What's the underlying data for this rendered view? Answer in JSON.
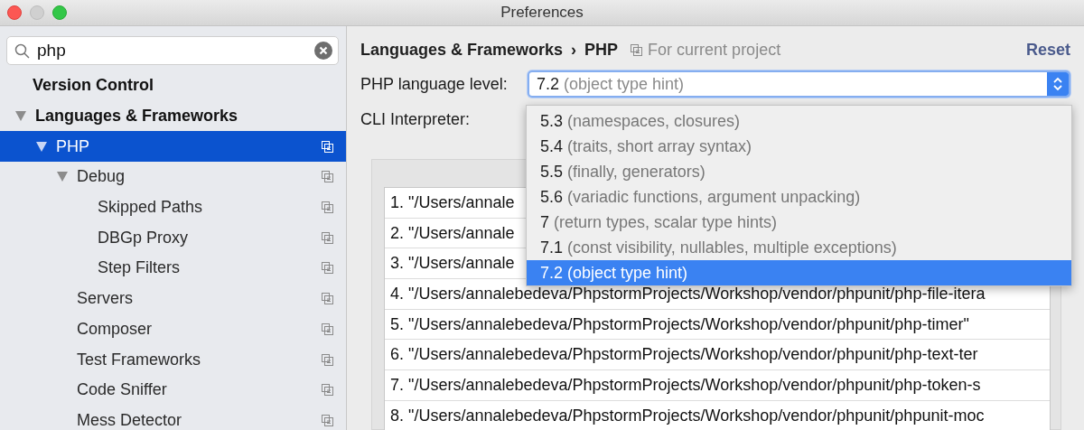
{
  "window": {
    "title": "Preferences"
  },
  "search": {
    "value": "php"
  },
  "tree": [
    {
      "label": "Version Control",
      "selected": false,
      "project_icon": false
    },
    {
      "label": "Languages & Frameworks",
      "expanded": true,
      "selected": false,
      "project_icon": false,
      "children": [
        {
          "label": "PHP",
          "expanded": true,
          "selected": true,
          "project_icon": true,
          "children": [
            {
              "label": "Debug",
              "expanded": true,
              "selected": false,
              "project_icon": true,
              "children": [
                {
                  "label": "Skipped Paths",
                  "selected": false,
                  "project_icon": true
                },
                {
                  "label": "DBGp Proxy",
                  "selected": false,
                  "project_icon": true
                },
                {
                  "label": "Step Filters",
                  "selected": false,
                  "project_icon": true
                }
              ]
            },
            {
              "label": "Servers",
              "selected": false,
              "project_icon": true
            },
            {
              "label": "Composer",
              "selected": false,
              "project_icon": true
            },
            {
              "label": "Test Frameworks",
              "selected": false,
              "project_icon": true
            },
            {
              "label": "Code Sniffer",
              "selected": false,
              "project_icon": true
            },
            {
              "label": "Mess Detector",
              "selected": false,
              "project_icon": true
            }
          ]
        }
      ]
    }
  ],
  "breadcrumb": {
    "parent": "Languages & Frameworks",
    "separator": "›",
    "current": "PHP",
    "scope": "For current project"
  },
  "reset": "Reset",
  "language_level": {
    "label": "PHP language level:",
    "version": "7.2",
    "description": "(object type hint)",
    "expanded": true,
    "options": [
      {
        "version": "5.3",
        "description": "(namespaces, closures)",
        "selected": false
      },
      {
        "version": "5.4",
        "description": "(traits, short array syntax)",
        "selected": false
      },
      {
        "version": "5.5",
        "description": "(finally, generators)",
        "selected": false
      },
      {
        "version": "5.6",
        "description": "(variadic functions, argument unpacking)",
        "selected": false
      },
      {
        "version": "7",
        "description": "(return types, scalar type hints)",
        "selected": false
      },
      {
        "version": "7.1",
        "description": "(const visibility, nullables, multiple exceptions)",
        "selected": false
      },
      {
        "version": "7.2",
        "description": "(object type hint)",
        "selected": true
      }
    ]
  },
  "cli_interpreter": {
    "label": "CLI Interpreter:"
  },
  "include_paths": [
    "1. \"/Users/annale",
    "2. \"/Users/annale",
    "3. \"/Users/annale",
    "4. \"/Users/annalebedeva/PhpstormProjects/Workshop/vendor/phpunit/php-file-itera",
    "5. \"/Users/annalebedeva/PhpstormProjects/Workshop/vendor/phpunit/php-timer\"",
    "6. \"/Users/annalebedeva/PhpstormProjects/Workshop/vendor/phpunit/php-text-ter",
    "7. \"/Users/annalebedeva/PhpstormProjects/Workshop/vendor/phpunit/php-token-s",
    "8. \"/Users/annalebedeva/PhpstormProjects/Workshop/vendor/phpunit/phpunit-moc"
  ]
}
